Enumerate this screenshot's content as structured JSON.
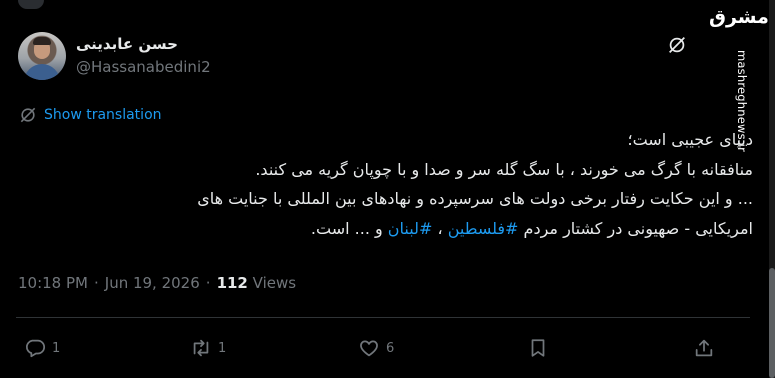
{
  "author": {
    "display_name": "حسن عابدینی",
    "handle": "@Hassanabedini2"
  },
  "translation": {
    "label": "Show translation"
  },
  "tweet": {
    "line1": "دنیای عجیبی است؛",
    "line2": "منافقانه با گرگ می خورند ، با سگ گله سر و صدا و با چوپان گریه می کنند.",
    "line3": "... و این حکایت رفتار برخی دولت های سرسپرده و نهادهای بین المللی با جنایت های",
    "line4_start": "امریکایی - صهیونی در  کشتار مردم ",
    "hashtag1": "#فلسطین",
    "line4_mid": " ، ",
    "hashtag2": "#لبنان",
    "line4_end": " و ... است."
  },
  "meta": {
    "time": "10:18 PM",
    "separator1": "·",
    "date": "Jun 19, 2026",
    "separator2": "·",
    "views_count": "112",
    "views_label": "Views"
  },
  "actions": {
    "replies": "1",
    "reposts": "1",
    "likes": "6",
    "bookmarks": "",
    "share": ""
  },
  "watermark": {
    "logo": "مشرق",
    "url": "mashreghnews.ir"
  },
  "colors": {
    "background": "#000000",
    "text": "#e7e9ea",
    "secondary": "#71767b",
    "link": "#1d9bf0"
  },
  "icons": [
    "grok-icon",
    "translate-icon",
    "reply-icon",
    "repost-icon",
    "like-icon",
    "bookmark-icon",
    "share-icon"
  ]
}
